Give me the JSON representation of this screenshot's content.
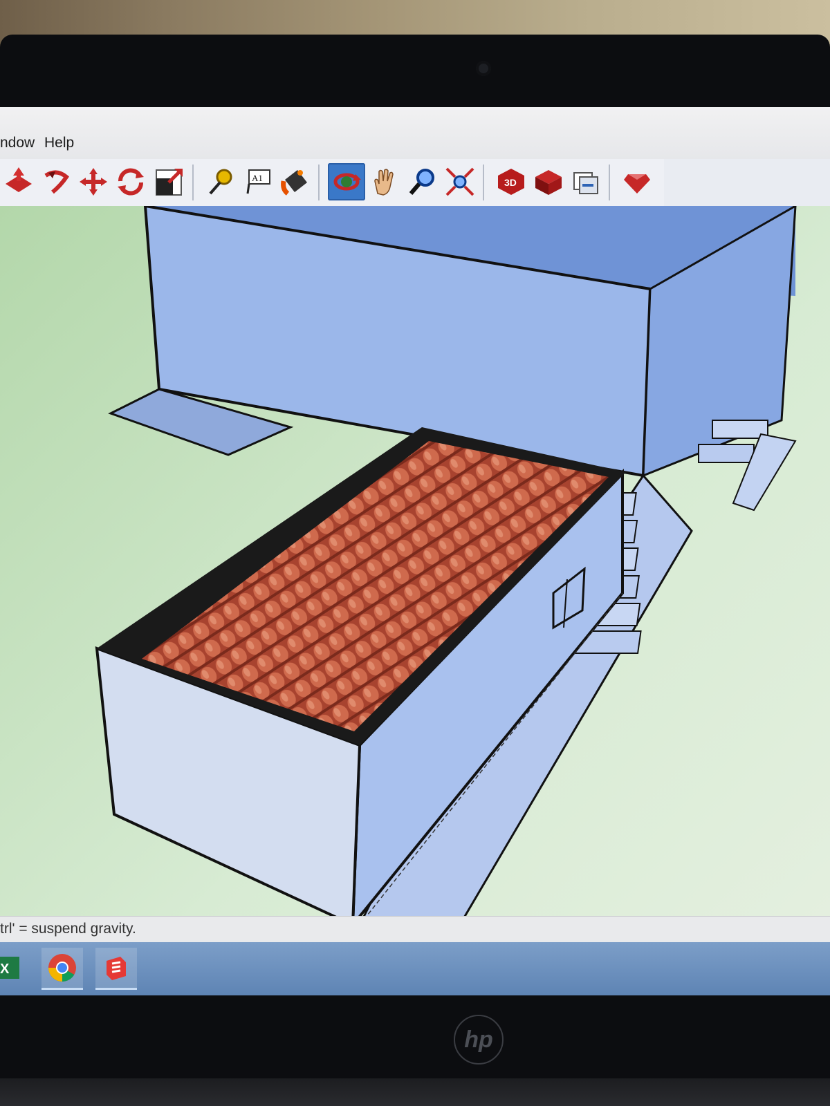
{
  "menubar": {
    "items": [
      "ndow",
      "Help"
    ]
  },
  "toolbar": {
    "tools": [
      {
        "name": "push-pull-icon"
      },
      {
        "name": "follow-me-icon"
      },
      {
        "name": "move-icon"
      },
      {
        "name": "rotate-icon"
      },
      {
        "name": "scale-icon"
      },
      {
        "name": "tape-measure-icon"
      },
      {
        "name": "text-icon",
        "label": "A1"
      },
      {
        "name": "paint-bucket-icon"
      },
      {
        "name": "orbit-icon",
        "active": true
      },
      {
        "name": "pan-icon"
      },
      {
        "name": "zoom-icon"
      },
      {
        "name": "zoom-extents-icon"
      },
      {
        "name": "3d-warehouse-icon"
      },
      {
        "name": "extension-warehouse-icon"
      },
      {
        "name": "send-to-layout-icon"
      },
      {
        "name": "ruby-console-icon"
      }
    ]
  },
  "statusbar": {
    "text": "trl' = suspend gravity."
  },
  "taskbar": {
    "apps": [
      "excel-icon",
      "chrome-icon",
      "sketchup-icon"
    ]
  },
  "branding": {
    "laptop_logo": "hp"
  },
  "colors": {
    "sky_blue": "#8fb0e8",
    "ground_green": "#cfe6cc",
    "roof_tile": "#b8553f",
    "active_tool": "#3a78c8"
  }
}
